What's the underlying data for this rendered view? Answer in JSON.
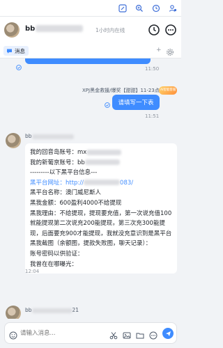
{
  "header": {
    "name_prefix": "bb",
    "status": "1小时内在线"
  },
  "tabs": {
    "active_label": "消息"
  },
  "messages": {
    "time_1": "11:50",
    "system_line": "XPJ黑金救援/爆奖【甜甜】11-23点在线",
    "ai_badge": "AI智能客服",
    "reply_bubble": "请填写一下表",
    "time_2": "11:51",
    "sender_prefix": "bb",
    "form_lines": [
      "我的回音岛账号：mx",
      "我的新葡京账号：bb",
      "---------以下黑平台信息---",
      "黑平台网址：http://",
      "黑平台名称：澳门威尼斯人",
      "黑我金额：600盈利4000不给提现",
      "黑我理由：不给提现，提现要充值，第一次说充值100就能提现第二次说充200能提现，第三次充300能提现，后面要充900才能提现，我就没充意识到是黑平台",
      "黑我截图（余额图，提款失败图，聊天记录）：",
      "账号密码以供验证：",
      "我曾在在哪曝光："
    ],
    "url_suffix": "083/",
    "time_3": "12:04",
    "next_sender_suffix": "21"
  },
  "input": {
    "placeholder": "请输入消息..."
  },
  "colors": {
    "accent": "#3f8cff",
    "background": "#f1f3f6"
  }
}
